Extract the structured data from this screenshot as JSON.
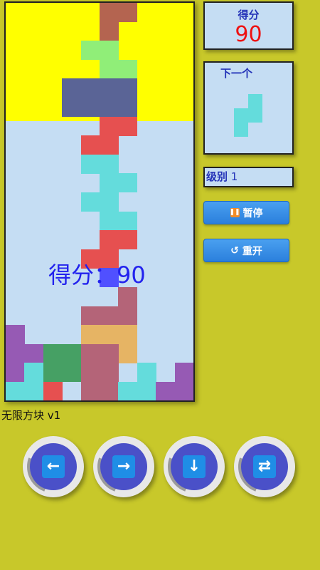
{
  "board": {
    "overlay_score": "得分：90",
    "danger_color": "#ffff00",
    "background_color": "#c5ddf3",
    "pieces": [
      {
        "name": "red-brown-s",
        "color": "#b46450",
        "cells": [
          [
            5,
            0
          ],
          [
            6,
            0
          ],
          [
            5,
            1
          ]
        ]
      },
      {
        "name": "light-green-piece",
        "color": "#90ee78",
        "cells": [
          [
            4,
            2
          ],
          [
            5,
            2
          ],
          [
            5,
            3
          ],
          [
            6,
            3
          ]
        ]
      },
      {
        "name": "slate-square",
        "color": "#5a6496",
        "cells": [
          [
            3,
            4
          ],
          [
            4,
            4
          ],
          [
            5,
            4
          ],
          [
            6,
            4
          ],
          [
            3,
            5
          ],
          [
            4,
            5
          ],
          [
            5,
            5
          ],
          [
            6,
            5
          ]
        ]
      },
      {
        "name": "red-piece-upper",
        "color": "#e65050",
        "cells": [
          [
            5,
            6
          ],
          [
            6,
            6
          ],
          [
            4,
            7
          ],
          [
            5,
            7
          ]
        ]
      },
      {
        "name": "cyan-piece-1",
        "color": "#64dcdc",
        "cells": [
          [
            4,
            8
          ],
          [
            5,
            8
          ],
          [
            5,
            9
          ],
          [
            6,
            9
          ]
        ]
      },
      {
        "name": "cyan-piece-2",
        "color": "#64dcdc",
        "cells": [
          [
            4,
            10
          ],
          [
            5,
            10
          ],
          [
            5,
            11
          ],
          [
            6,
            11
          ]
        ]
      },
      {
        "name": "red-piece-lower",
        "color": "#e65050",
        "cells": [
          [
            5,
            12
          ],
          [
            6,
            12
          ],
          [
            4,
            13
          ],
          [
            5,
            13
          ]
        ]
      },
      {
        "name": "blue-highlight-piece",
        "color": "#5050ff",
        "cells": [
          [
            5,
            14
          ]
        ]
      },
      {
        "name": "mauve-piece",
        "color": "#b46478",
        "cells": [
          [
            6,
            15
          ],
          [
            4,
            16
          ],
          [
            5,
            16
          ],
          [
            6,
            16
          ]
        ]
      },
      {
        "name": "orange-piece",
        "color": "#e6b464",
        "cells": [
          [
            4,
            17
          ],
          [
            5,
            17
          ],
          [
            6,
            17
          ],
          [
            6,
            18
          ]
        ]
      },
      {
        "name": "mauve-stack",
        "color": "#b46478",
        "cells": [
          [
            4,
            18
          ],
          [
            5,
            18
          ],
          [
            4,
            19
          ],
          [
            5,
            19
          ],
          [
            4,
            20
          ],
          [
            5,
            20
          ]
        ]
      },
      {
        "name": "green-square",
        "color": "#46a064",
        "cells": [
          [
            2,
            18
          ],
          [
            3,
            18
          ],
          [
            2,
            19
          ],
          [
            3,
            19
          ]
        ]
      },
      {
        "name": "purple-left",
        "color": "#965ab4",
        "cells": [
          [
            0,
            17
          ],
          [
            0,
            18
          ],
          [
            1,
            18
          ],
          [
            0,
            19
          ]
        ]
      },
      {
        "name": "cyan-bottom-left",
        "color": "#64dcdc",
        "cells": [
          [
            1,
            19
          ],
          [
            0,
            20
          ],
          [
            1,
            20
          ]
        ]
      },
      {
        "name": "red-bottom",
        "color": "#e65050",
        "cells": [
          [
            2,
            20
          ]
        ]
      },
      {
        "name": "cyan-bottom-right",
        "color": "#64dcdc",
        "cells": [
          [
            7,
            19
          ],
          [
            6,
            20
          ],
          [
            7,
            20
          ]
        ]
      },
      {
        "name": "purple-bottom-right",
        "color": "#965ab4",
        "cells": [
          [
            9,
            19
          ],
          [
            8,
            20
          ],
          [
            9,
            20
          ]
        ]
      }
    ]
  },
  "score_panel": {
    "title": "得分",
    "value": "90"
  },
  "next_panel": {
    "title": "下一个",
    "color": "#64dcdc",
    "cells": [
      [
        1,
        0
      ],
      [
        0,
        1
      ],
      [
        1,
        1
      ],
      [
        0,
        2
      ]
    ]
  },
  "level_panel": {
    "label": "级别",
    "value": "1"
  },
  "buttons": {
    "pause": {
      "icon": "pause-icon",
      "label": "暂停"
    },
    "restart": {
      "icon": "refresh-icon",
      "glyph": "↺",
      "label": "重开"
    }
  },
  "footer": {
    "app_label": "无限方块 v1"
  },
  "controls": [
    {
      "name": "move-left",
      "icon": "arrow-left-icon",
      "glyph": "←"
    },
    {
      "name": "move-right",
      "icon": "arrow-right-icon",
      "glyph": "→"
    },
    {
      "name": "drop-down",
      "icon": "arrow-down-icon",
      "glyph": "↓"
    },
    {
      "name": "rotate",
      "icon": "rotate-icon",
      "glyph": "⇄"
    }
  ]
}
